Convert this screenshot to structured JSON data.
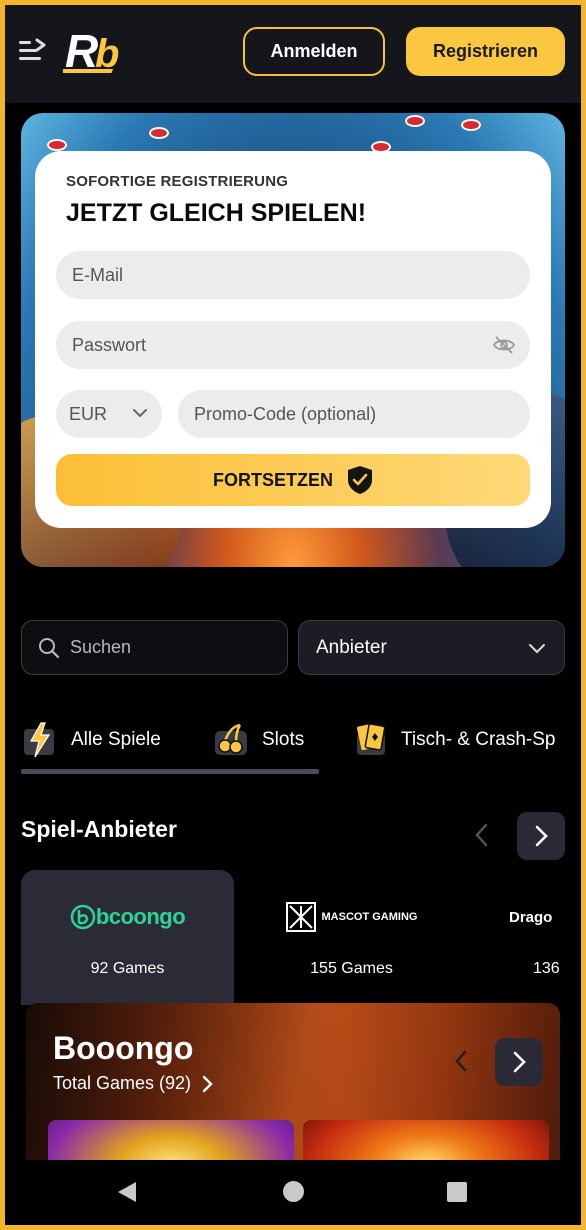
{
  "header": {
    "login_label": "Anmelden",
    "register_label": "Registrieren",
    "logo_text": "Rb"
  },
  "signup": {
    "kicker": "SOFORTIGE REGISTRIERUNG",
    "title": "JETZT GLEICH SPIELEN!",
    "email_placeholder": "E-Mail",
    "password_placeholder": "Passwort",
    "currency": "EUR",
    "promo_placeholder": "Promo-Code (optional)",
    "continue_label": "FORTSETZEN"
  },
  "filters": {
    "search_placeholder": "Suchen",
    "provider_label": "Anbieter"
  },
  "tabs": [
    {
      "label": "Alle Spiele",
      "icon": "lightning-icon",
      "active": true
    },
    {
      "label": "Slots",
      "icon": "cherry-icon",
      "active": false
    },
    {
      "label": "Tisch- & Crash-Sp",
      "icon": "cards-icon",
      "active": false
    }
  ],
  "providers_section": {
    "title": "Spiel-Anbieter",
    "providers": [
      {
        "name": "bcoongo",
        "count": "92 Games"
      },
      {
        "name": "MASCOT GAMING",
        "count": "155 Games"
      },
      {
        "name": "Drago",
        "count": "136"
      }
    ]
  },
  "featured": {
    "title": "Booongo",
    "subtitle": "Total Games (92)"
  },
  "colors": {
    "accent": "#fbc640",
    "frame": "#f3b52a",
    "boongo_green": "#2bd495"
  }
}
